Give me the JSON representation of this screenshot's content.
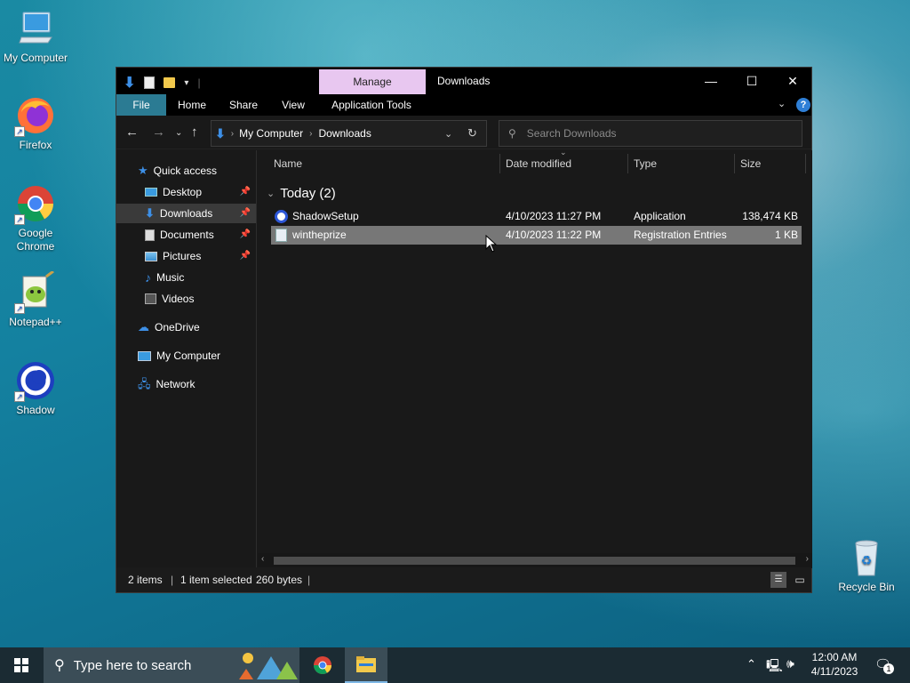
{
  "desktop": {
    "icons": [
      {
        "label": "My Computer"
      },
      {
        "label": "Firefox"
      },
      {
        "label": "Google Chrome"
      },
      {
        "label": "Notepad++"
      },
      {
        "label": "Shadow"
      },
      {
        "label": "Recycle Bin"
      }
    ]
  },
  "window": {
    "title": "Downloads",
    "context_tab": "Manage",
    "ribbon_tabs": [
      "File",
      "Home",
      "Share",
      "View",
      "Application Tools"
    ],
    "address": {
      "root": "My Computer",
      "current": "Downloads"
    },
    "search_placeholder": "Search Downloads",
    "nav": {
      "quick_access": "Quick access",
      "items": [
        {
          "label": "Desktop",
          "pinned": true
        },
        {
          "label": "Downloads",
          "pinned": true,
          "selected": true
        },
        {
          "label": "Documents",
          "pinned": true
        },
        {
          "label": "Pictures",
          "pinned": true
        },
        {
          "label": "Music",
          "pinned": false
        },
        {
          "label": "Videos",
          "pinned": false
        }
      ],
      "onedrive": "OneDrive",
      "my_computer": "My Computer",
      "network": "Network"
    },
    "columns": [
      "Name",
      "Date modified",
      "Type",
      "Size"
    ],
    "group": "Today (2)",
    "files": [
      {
        "name": "ShadowSetup",
        "date": "4/10/2023 11:27 PM",
        "type": "Application",
        "size": "138,474 KB",
        "selected": false
      },
      {
        "name": "wintheprize",
        "date": "4/10/2023 11:22 PM",
        "type": "Registration Entries",
        "size": "1 KB",
        "selected": true
      }
    ],
    "status": {
      "count": "2 items",
      "selection": "1 item selected",
      "bytes": "260 bytes"
    }
  },
  "taskbar": {
    "search_placeholder": "Type here to search",
    "time": "12:00 AM",
    "date": "4/11/2023",
    "notification_count": "1"
  },
  "colors": {
    "manage_tab": "#e8c7f0",
    "file_tab": "#2b7b93",
    "window_bg": "#191919",
    "taskbar": "#1b2b33"
  }
}
